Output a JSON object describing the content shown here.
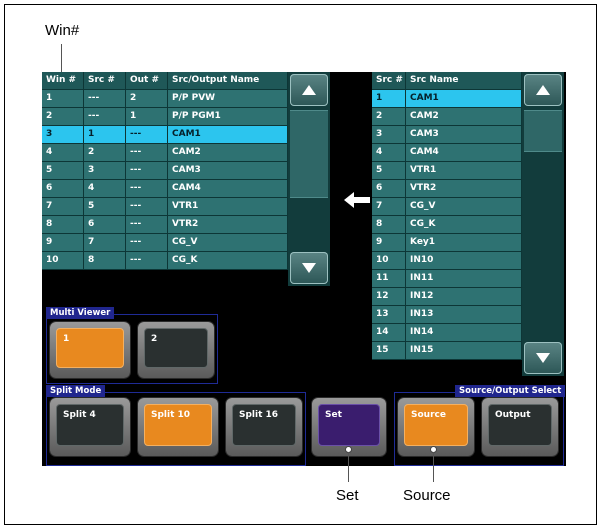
{
  "callouts": {
    "win": "Win#",
    "set": "Set",
    "source": "Source"
  },
  "left_table": {
    "headers": [
      "Win #",
      "Src #",
      "Out #",
      "Src/Output Name"
    ],
    "rows": [
      [
        "1",
        "---",
        "2",
        "P/P PVW"
      ],
      [
        "2",
        "---",
        "1",
        "P/P PGM1"
      ],
      [
        "3",
        "1",
        "---",
        "CAM1"
      ],
      [
        "4",
        "2",
        "---",
        "CAM2"
      ],
      [
        "5",
        "3",
        "---",
        "CAM3"
      ],
      [
        "6",
        "4",
        "---",
        "CAM4"
      ],
      [
        "7",
        "5",
        "---",
        "VTR1"
      ],
      [
        "8",
        "6",
        "---",
        "VTR2"
      ],
      [
        "9",
        "7",
        "---",
        "CG_V"
      ],
      [
        "10",
        "8",
        "---",
        "CG_K"
      ]
    ],
    "selected_row": 3
  },
  "right_table": {
    "headers": [
      "Src #",
      "Src Name"
    ],
    "rows": [
      [
        "1",
        "CAM1"
      ],
      [
        "2",
        "CAM2"
      ],
      [
        "3",
        "CAM3"
      ],
      [
        "4",
        "CAM4"
      ],
      [
        "5",
        "VTR1"
      ],
      [
        "6",
        "VTR2"
      ],
      [
        "7",
        "CG_V"
      ],
      [
        "8",
        "CG_K"
      ],
      [
        "9",
        "Key1"
      ],
      [
        "10",
        "IN10"
      ],
      [
        "11",
        "IN11"
      ],
      [
        "12",
        "IN12"
      ],
      [
        "13",
        "IN13"
      ],
      [
        "14",
        "IN14"
      ],
      [
        "15",
        "IN15"
      ]
    ],
    "selected_row": 1
  },
  "multi_viewer": {
    "title": "Multi Viewer",
    "buttons": [
      "1",
      "2"
    ],
    "active": "1"
  },
  "split_mode": {
    "title": "Split Mode",
    "buttons": [
      "Split 4",
      "Split 10",
      "Split 16"
    ],
    "active": "Split 10"
  },
  "set_button": {
    "label": "Set"
  },
  "source_output": {
    "title": "Source/Output Select",
    "buttons": [
      "Source",
      "Output"
    ],
    "active": "Source"
  },
  "colors": {
    "cell": "#2e7272",
    "selected": "#2cc5ee",
    "active_button": "#e8891f",
    "set_button": "#3a1d6e",
    "group_title": "#20268e"
  },
  "icons": [
    "scroll-up-icon",
    "scroll-down-icon",
    "left-arrow-icon"
  ]
}
